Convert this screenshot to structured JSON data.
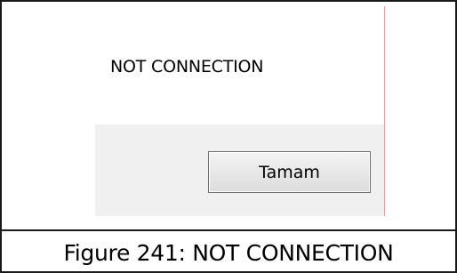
{
  "dialog": {
    "message": "NOT CONNECTION",
    "ok_label": "Tamam"
  },
  "caption": {
    "text": "Figure 241: NOT CONNECTION"
  }
}
